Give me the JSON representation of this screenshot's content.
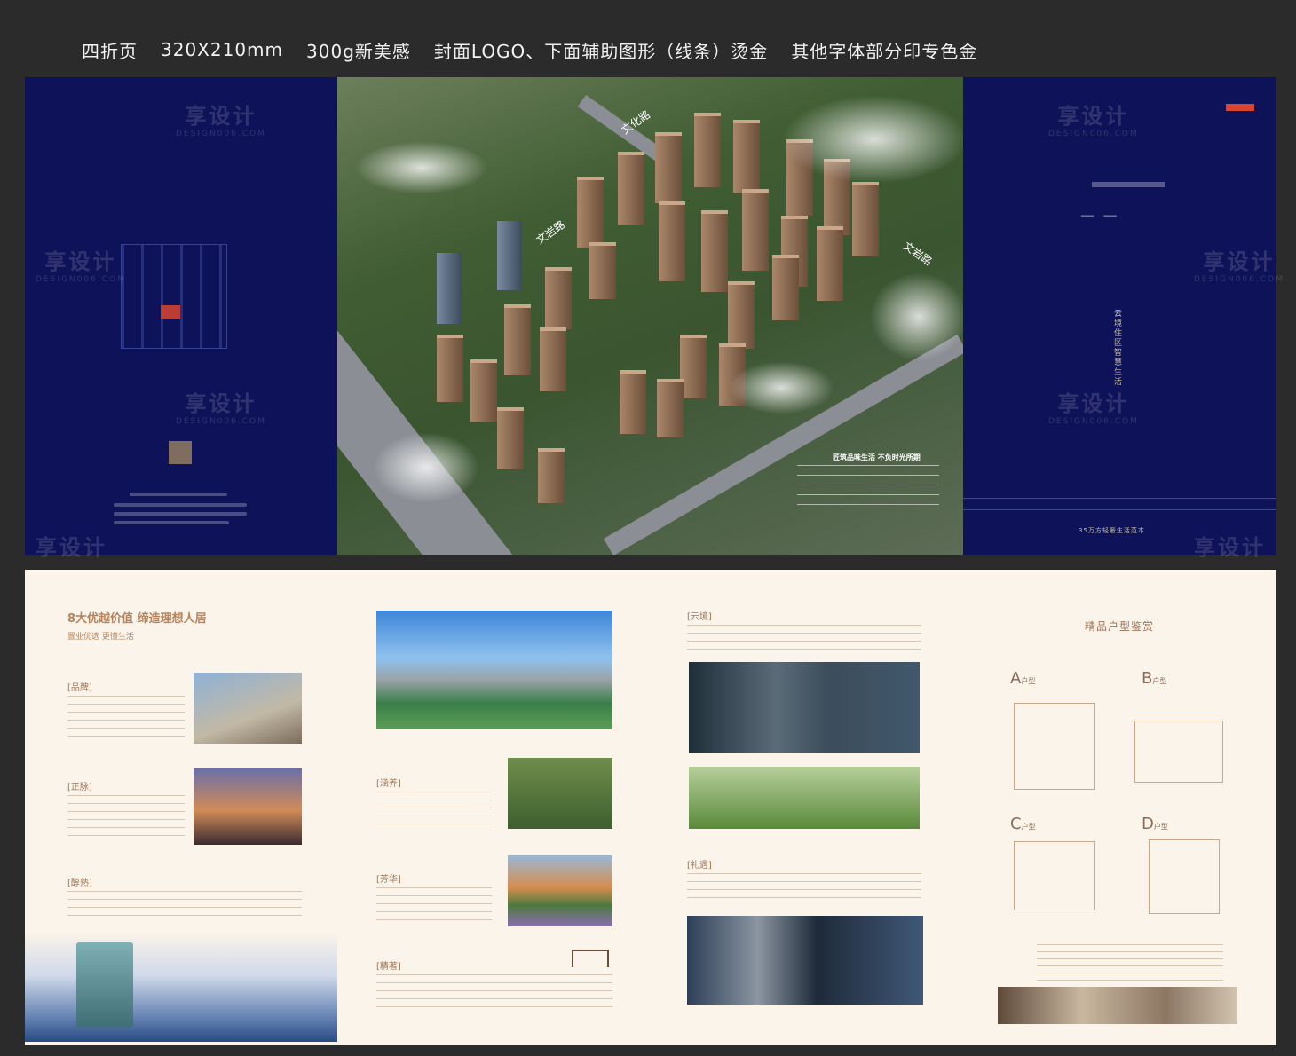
{
  "header": {
    "fold": "四折页",
    "size": "320X210mm",
    "paper": "300g新美感",
    "foil": "封面LOGO、下面辅助图形（线条）烫金",
    "spot": "其他字体部分印专色金"
  },
  "watermark": {
    "cn": "享设计",
    "en": "DESIGN006.COM"
  },
  "aerial": {
    "road1": "文化路",
    "road2": "文岩路",
    "road3": "文岩路",
    "caption_title": "匠筑品味生活 不负时光所期"
  },
  "cover": {
    "vertical_text": "云境住区 智慧生活",
    "slogan": "35万方轻奢生活范本"
  },
  "inside": {
    "title": "8大优越价值 缔造理想人居",
    "subtitle": "置业优选 更懂生活",
    "sections": [
      "[品牌]",
      "[正脉]",
      "[醇熟]",
      "[涵养]",
      "[芳华]",
      "[精著]",
      "[云境]",
      "[礼遇]"
    ],
    "floorplan_title": "精品户型鉴赏",
    "floorplans": [
      "A",
      "B",
      "C",
      "D"
    ],
    "floorplan_suffix": "户型"
  },
  "colors": {
    "navy": "#0e1258",
    "cream": "#fbf4ea",
    "gold": "#b6835c"
  }
}
